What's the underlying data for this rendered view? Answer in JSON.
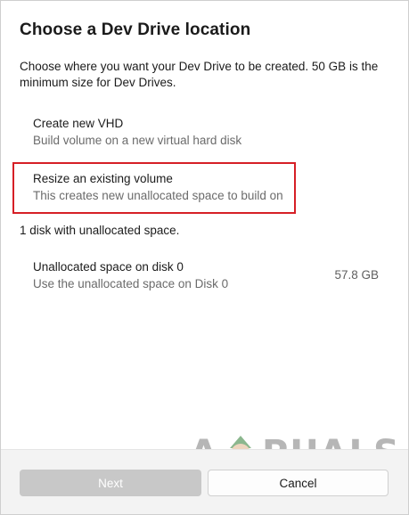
{
  "dialog": {
    "title": "Choose a Dev Drive location",
    "description": "Choose where you want your Dev Drive to be created. 50 GB is the minimum size for Dev Drives."
  },
  "options": [
    {
      "title": "Create new VHD",
      "subtitle": "Build volume on a new virtual hard disk"
    },
    {
      "title": "Resize an existing volume",
      "subtitle": "This creates new unallocated space to build on"
    }
  ],
  "unallocated": {
    "label": "1 disk with unallocated space.",
    "disks": [
      {
        "title": "Unallocated space on disk 0",
        "subtitle": "Use the unallocated space on Disk 0",
        "size": "57.8 GB"
      }
    ]
  },
  "footer": {
    "next_label": "Next",
    "cancel_label": "Cancel"
  },
  "watermark": {
    "first_letter": "A",
    "rest": "PUALS"
  },
  "colors": {
    "highlight": "#d61f26",
    "disabled_button": "#c8c8c8",
    "footer_bg": "#f3f3f3"
  }
}
